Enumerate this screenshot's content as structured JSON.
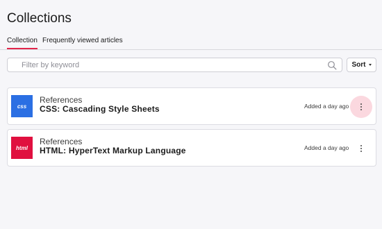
{
  "page": {
    "title": "Collections"
  },
  "tabs": [
    {
      "label": "Collection",
      "active": true
    },
    {
      "label": "Frequently viewed articles",
      "active": false
    }
  ],
  "search": {
    "placeholder": "Filter by keyword",
    "value": ""
  },
  "sort": {
    "label": "Sort"
  },
  "items": [
    {
      "badge": "css",
      "badge_color": "#2b6fe3",
      "kicker": "References",
      "title": "CSS: Cascading Style Sheets",
      "added": "Added a day ago",
      "menu_hovered": true
    },
    {
      "badge": "html",
      "badge_color": "#e0103f",
      "kicker": "References",
      "title": "HTML: HyperText Markup Language",
      "added": "Added a day ago",
      "menu_hovered": false
    }
  ],
  "colors": {
    "accent": "#e2254b",
    "background": "#f6f6f9",
    "hover": "#fbd8df"
  }
}
